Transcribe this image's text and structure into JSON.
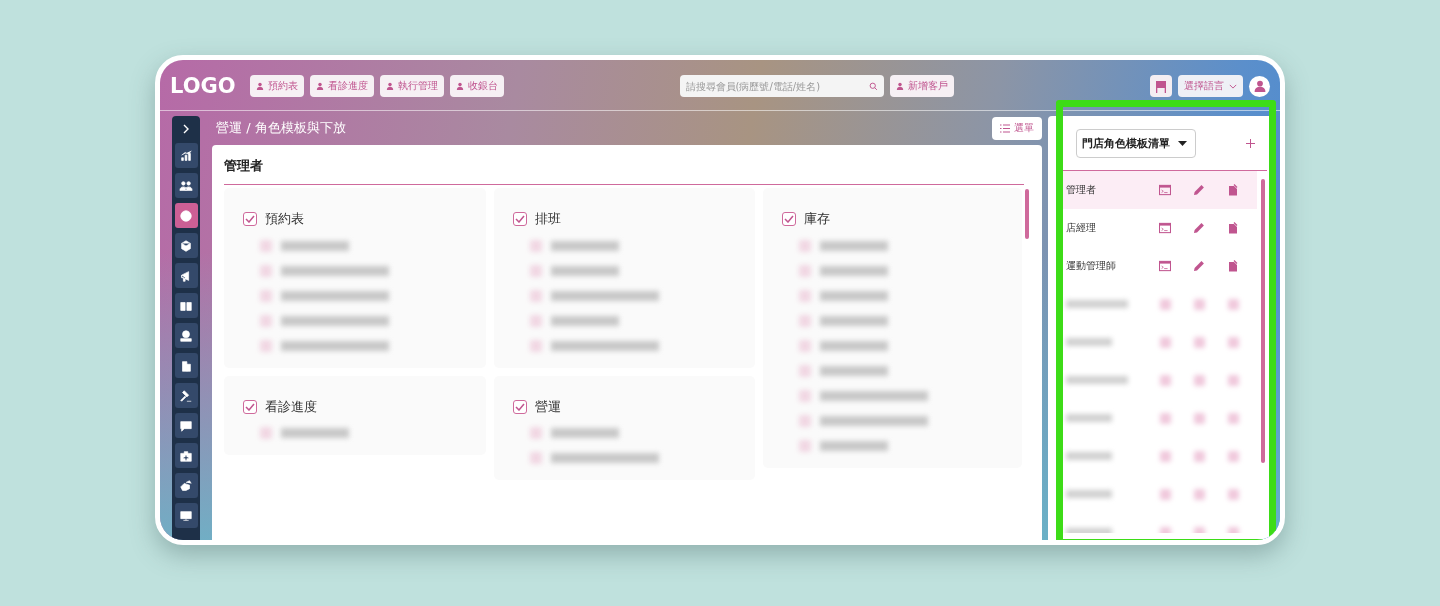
{
  "header": {
    "logo": "LOGO",
    "nav_buttons": [
      "預約表",
      "看診進度",
      "執行管理",
      "收銀台"
    ],
    "search": {
      "placeholder": "請搜尋會員(病歷號/電話/姓名)"
    },
    "add_button": "新增客戶",
    "language": "選擇語言"
  },
  "sidebar": {
    "items": [
      {
        "selected": false
      },
      {
        "selected": false
      },
      {
        "selected": true
      },
      {
        "selected": false
      },
      {
        "selected": false
      },
      {
        "selected": false
      },
      {
        "selected": false
      },
      {
        "selected": false
      },
      {
        "selected": false
      },
      {
        "selected": false
      },
      {
        "selected": false
      },
      {
        "selected": false
      },
      {
        "selected": false
      }
    ]
  },
  "breadcrumb": "營運 / 角色模板與下放",
  "menu_button": "選單",
  "role_panel": {
    "title": "管理者",
    "columns": [
      [
        {
          "label": "預約表",
          "checked": true,
          "items": [
            {
              "kind": "short"
            },
            {
              "kind": "long"
            },
            {
              "kind": "long"
            },
            {
              "kind": "long"
            },
            {
              "kind": "long"
            }
          ]
        },
        {
          "label": "看診進度",
          "checked": true,
          "items": [
            {
              "kind": "short"
            }
          ]
        }
      ],
      [
        {
          "label": "排班",
          "checked": true,
          "items": [
            {
              "kind": "short"
            },
            {
              "kind": "short"
            },
            {
              "kind": "long"
            },
            {
              "kind": "short"
            },
            {
              "kind": "long"
            }
          ]
        },
        {
          "label": "營運",
          "checked": true,
          "items": [
            {
              "kind": "short"
            },
            {
              "kind": "long"
            }
          ]
        }
      ],
      [
        {
          "label": "庫存",
          "checked": true,
          "items": [
            {
              "kind": "short"
            },
            {
              "kind": "short"
            },
            {
              "kind": "short"
            },
            {
              "kind": "short"
            },
            {
              "kind": "short"
            },
            {
              "kind": "short"
            },
            {
              "kind": "long"
            },
            {
              "kind": "long"
            },
            {
              "kind": "short"
            }
          ]
        }
      ]
    ]
  },
  "template_list": {
    "dropdown": "門店角色模板清單",
    "rows": [
      {
        "kind": "text",
        "name": "管理者",
        "selected": true
      },
      {
        "kind": "text",
        "name": "店經理",
        "selected": false
      },
      {
        "kind": "text",
        "name": "運動管理師",
        "selected": false
      },
      {
        "kind": "blurred_long",
        "selected": false
      },
      {
        "kind": "blurred_short",
        "selected": false
      },
      {
        "kind": "blurred_long",
        "selected": false
      },
      {
        "kind": "blurred_short",
        "selected": false
      },
      {
        "kind": "blurred_short",
        "selected": false
      },
      {
        "kind": "blurred_short",
        "selected": false
      },
      {
        "kind": "blurred_short",
        "selected": false
      }
    ]
  }
}
